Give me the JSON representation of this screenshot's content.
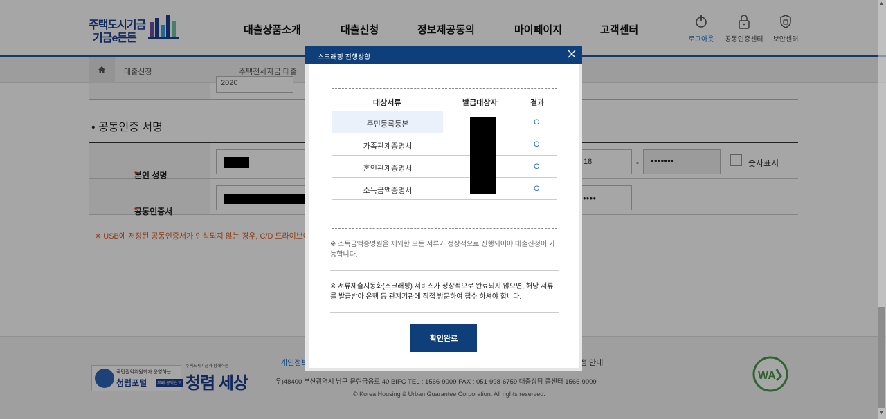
{
  "header": {
    "logo_line1": "주택도시기금",
    "logo_line2": "기금e든든",
    "nav": [
      "대출상품소개",
      "대출신청",
      "정보제공동의",
      "마이페이지",
      "고객센터"
    ],
    "utilities": [
      {
        "label": "로그아웃",
        "icon": "power-icon",
        "color": "#1e73c8"
      },
      {
        "label": "공동인증센터",
        "icon": "lock-icon"
      },
      {
        "label": "보안센터",
        "icon": "shield-icon"
      }
    ]
  },
  "breadcrumb": {
    "items": [
      "대출신청",
      "주택전세자금 대출"
    ]
  },
  "form": {
    "partial_row_value": "2020",
    "section_title": "• 공동인증 서명",
    "name_label": "본인 성명",
    "cert_label": "공동인증서",
    "required_mark": "*",
    "rrn_suffix": "18",
    "rrn_dash": "-",
    "rrn_masked": "●●●●●●●",
    "cert_pw_masked": "●●●●●",
    "show_digits_label": "숫자표시",
    "usb_warning": "※ USB에 저장된 공동인증서가 인식되지 않는 경우, C/D 드라이브에"
  },
  "footer": {
    "links_left": "개인정보",
    "links_right": "정 안내",
    "address": "우)48400 부산광역시 남구 문현금융로 40 BIFC    TEL : 1566-9009    FAX : 051-998-6759    대출상담 콜센터 1566-9009",
    "copyright": "© Korea Housing & Urban Guarantee Corporation. All rights reserved.",
    "badge1_line1": "국민권익위원회가 운영하는",
    "badge1_line2": "청렴포털",
    "badge1_tag": "부패·공익신고",
    "badge2_line1": "주택도시기금과 함께하는",
    "badge2_line2": "청렴 세상"
  },
  "modal": {
    "title": "스크래핑 진행상황",
    "table_headers": [
      "대상서류",
      "발급대상자",
      "결과"
    ],
    "rows": [
      {
        "document": "주민등록등본",
        "result": "O"
      },
      {
        "document": "가족관계증명서",
        "result": "O"
      },
      {
        "document": "혼인관계증명서",
        "result": "O"
      },
      {
        "document": "소득금액증명서",
        "result": "O"
      }
    ],
    "note1": "※ 소득금액증명원을 제외한 모든 서류가 정상적으로 진행되어야 대출신청이 가능합니다.",
    "note2": "※ 서류제출지동화(스크래핑) 서비스가 정상적으로 완료되지 않으면, 해당 서류를 발급받아 은행 등 관계기관에 직접 방문하여 접수 하셔야 합니다.",
    "confirm_label": "확인완료"
  },
  "colors": {
    "brand_navy": "#0e3f7a",
    "link_blue": "#1e73c8",
    "warning_orange": "#e05a1e"
  }
}
